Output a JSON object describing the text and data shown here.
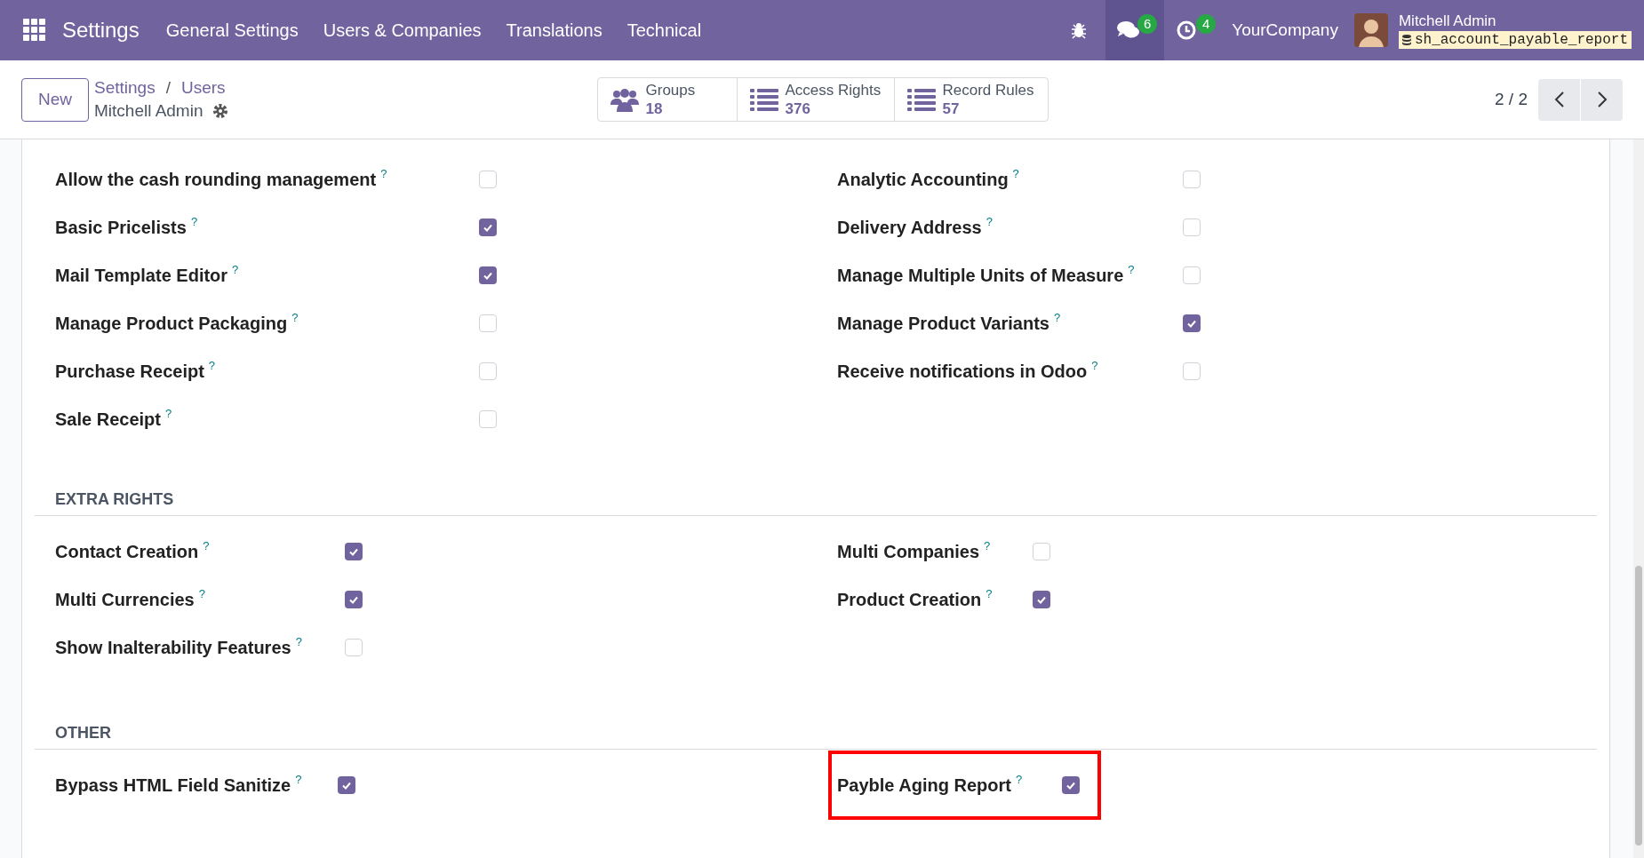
{
  "navbar": {
    "app_title": "Settings",
    "menus": [
      "General Settings",
      "Users & Companies",
      "Translations",
      "Technical"
    ],
    "messages_count": "6",
    "activities_count": "4",
    "company": "YourCompany",
    "user_name": "Mitchell Admin",
    "database": "sh_account_payable_report"
  },
  "help_mark": "?",
  "control_panel": {
    "new_button": "New",
    "breadcrumbs": [
      "Settings",
      "Users"
    ],
    "breadcrumb_separator": "/",
    "record_title": "Mitchell Admin",
    "stat_buttons": [
      {
        "label": "Groups",
        "value": "18",
        "kind": "groups"
      },
      {
        "label": "Access Rights",
        "value": "376",
        "kind": "list"
      },
      {
        "label": "Record Rules",
        "value": "57",
        "kind": "list"
      }
    ],
    "pager": "2 / 2"
  },
  "sections": [
    {
      "rows": [
        {
          "left": {
            "label": "Allow the cash rounding management",
            "checked": false
          },
          "right": {
            "label": "Analytic Accounting",
            "checked": false
          }
        },
        {
          "left": {
            "label": "Basic Pricelists",
            "checked": true
          },
          "right": {
            "label": "Delivery Address",
            "checked": false
          }
        },
        {
          "left": {
            "label": "Mail Template Editor",
            "checked": true
          },
          "right": {
            "label": "Manage Multiple Units of Measure",
            "checked": false
          }
        },
        {
          "left": {
            "label": "Manage Product Packaging",
            "checked": false
          },
          "right": {
            "label": "Manage Product Variants",
            "checked": true
          }
        },
        {
          "left": {
            "label": "Purchase Receipt",
            "checked": false
          },
          "right": {
            "label": "Receive notifications in Odoo",
            "checked": false
          }
        },
        {
          "left": {
            "label": "Sale Receipt",
            "checked": false
          }
        }
      ]
    },
    {
      "title": "EXTRA RIGHTS",
      "rows": [
        {
          "left": {
            "label": "Contact Creation",
            "checked": true
          },
          "right": {
            "label": "Multi Companies",
            "checked": false
          }
        },
        {
          "left": {
            "label": "Multi Currencies",
            "checked": true
          },
          "right": {
            "label": "Product Creation",
            "checked": true
          }
        },
        {
          "left": {
            "label": "Show Inalterability Features",
            "checked": false
          }
        }
      ]
    },
    {
      "title": "OTHER",
      "rows": [
        {
          "left": {
            "label": "Bypass HTML Field Sanitize",
            "checked": true
          },
          "right": {
            "label": "Payble Aging Report",
            "checked": true,
            "highlighted": true
          }
        }
      ]
    }
  ]
}
